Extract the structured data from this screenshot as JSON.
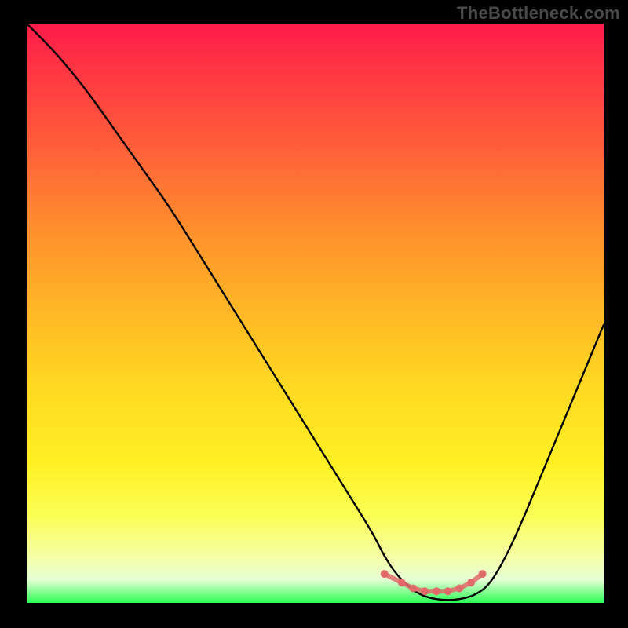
{
  "watermark": "TheBottleneck.com",
  "chart_data": {
    "type": "line",
    "title": "",
    "xlabel": "",
    "ylabel": "",
    "xlim": [
      0,
      100
    ],
    "ylim": [
      0,
      100
    ],
    "grid": false,
    "series": [
      {
        "name": "bottleneck-curve",
        "color": "#000000",
        "x": [
          0,
          5,
          10,
          15,
          20,
          25,
          30,
          35,
          40,
          45,
          50,
          55,
          60,
          62,
          64,
          66,
          68,
          70,
          72,
          74,
          76,
          78,
          80,
          82,
          85,
          90,
          95,
          100
        ],
        "y": [
          100,
          95,
          89,
          82,
          75,
          68,
          60,
          52,
          44,
          36,
          28,
          20,
          12,
          8,
          5,
          3,
          1.5,
          0.8,
          0.5,
          0.5,
          0.8,
          1.5,
          3,
          6,
          12,
          24,
          36,
          48
        ]
      },
      {
        "name": "sweet-spot-markers",
        "color": "#e06a6a",
        "type": "scatter",
        "x": [
          62,
          65,
          67,
          69,
          71,
          73,
          75,
          77,
          79
        ],
        "y": [
          5,
          3.5,
          2.5,
          2,
          2,
          2,
          2.5,
          3.5,
          5
        ]
      }
    ],
    "gradient_stops": [
      {
        "pos": 0,
        "color": "#ff1a4b"
      },
      {
        "pos": 20,
        "color": "#ff5a3a"
      },
      {
        "pos": 48,
        "color": "#ffb326"
      },
      {
        "pos": 76,
        "color": "#fff024"
      },
      {
        "pos": 100,
        "color": "#2bff55"
      }
    ]
  }
}
